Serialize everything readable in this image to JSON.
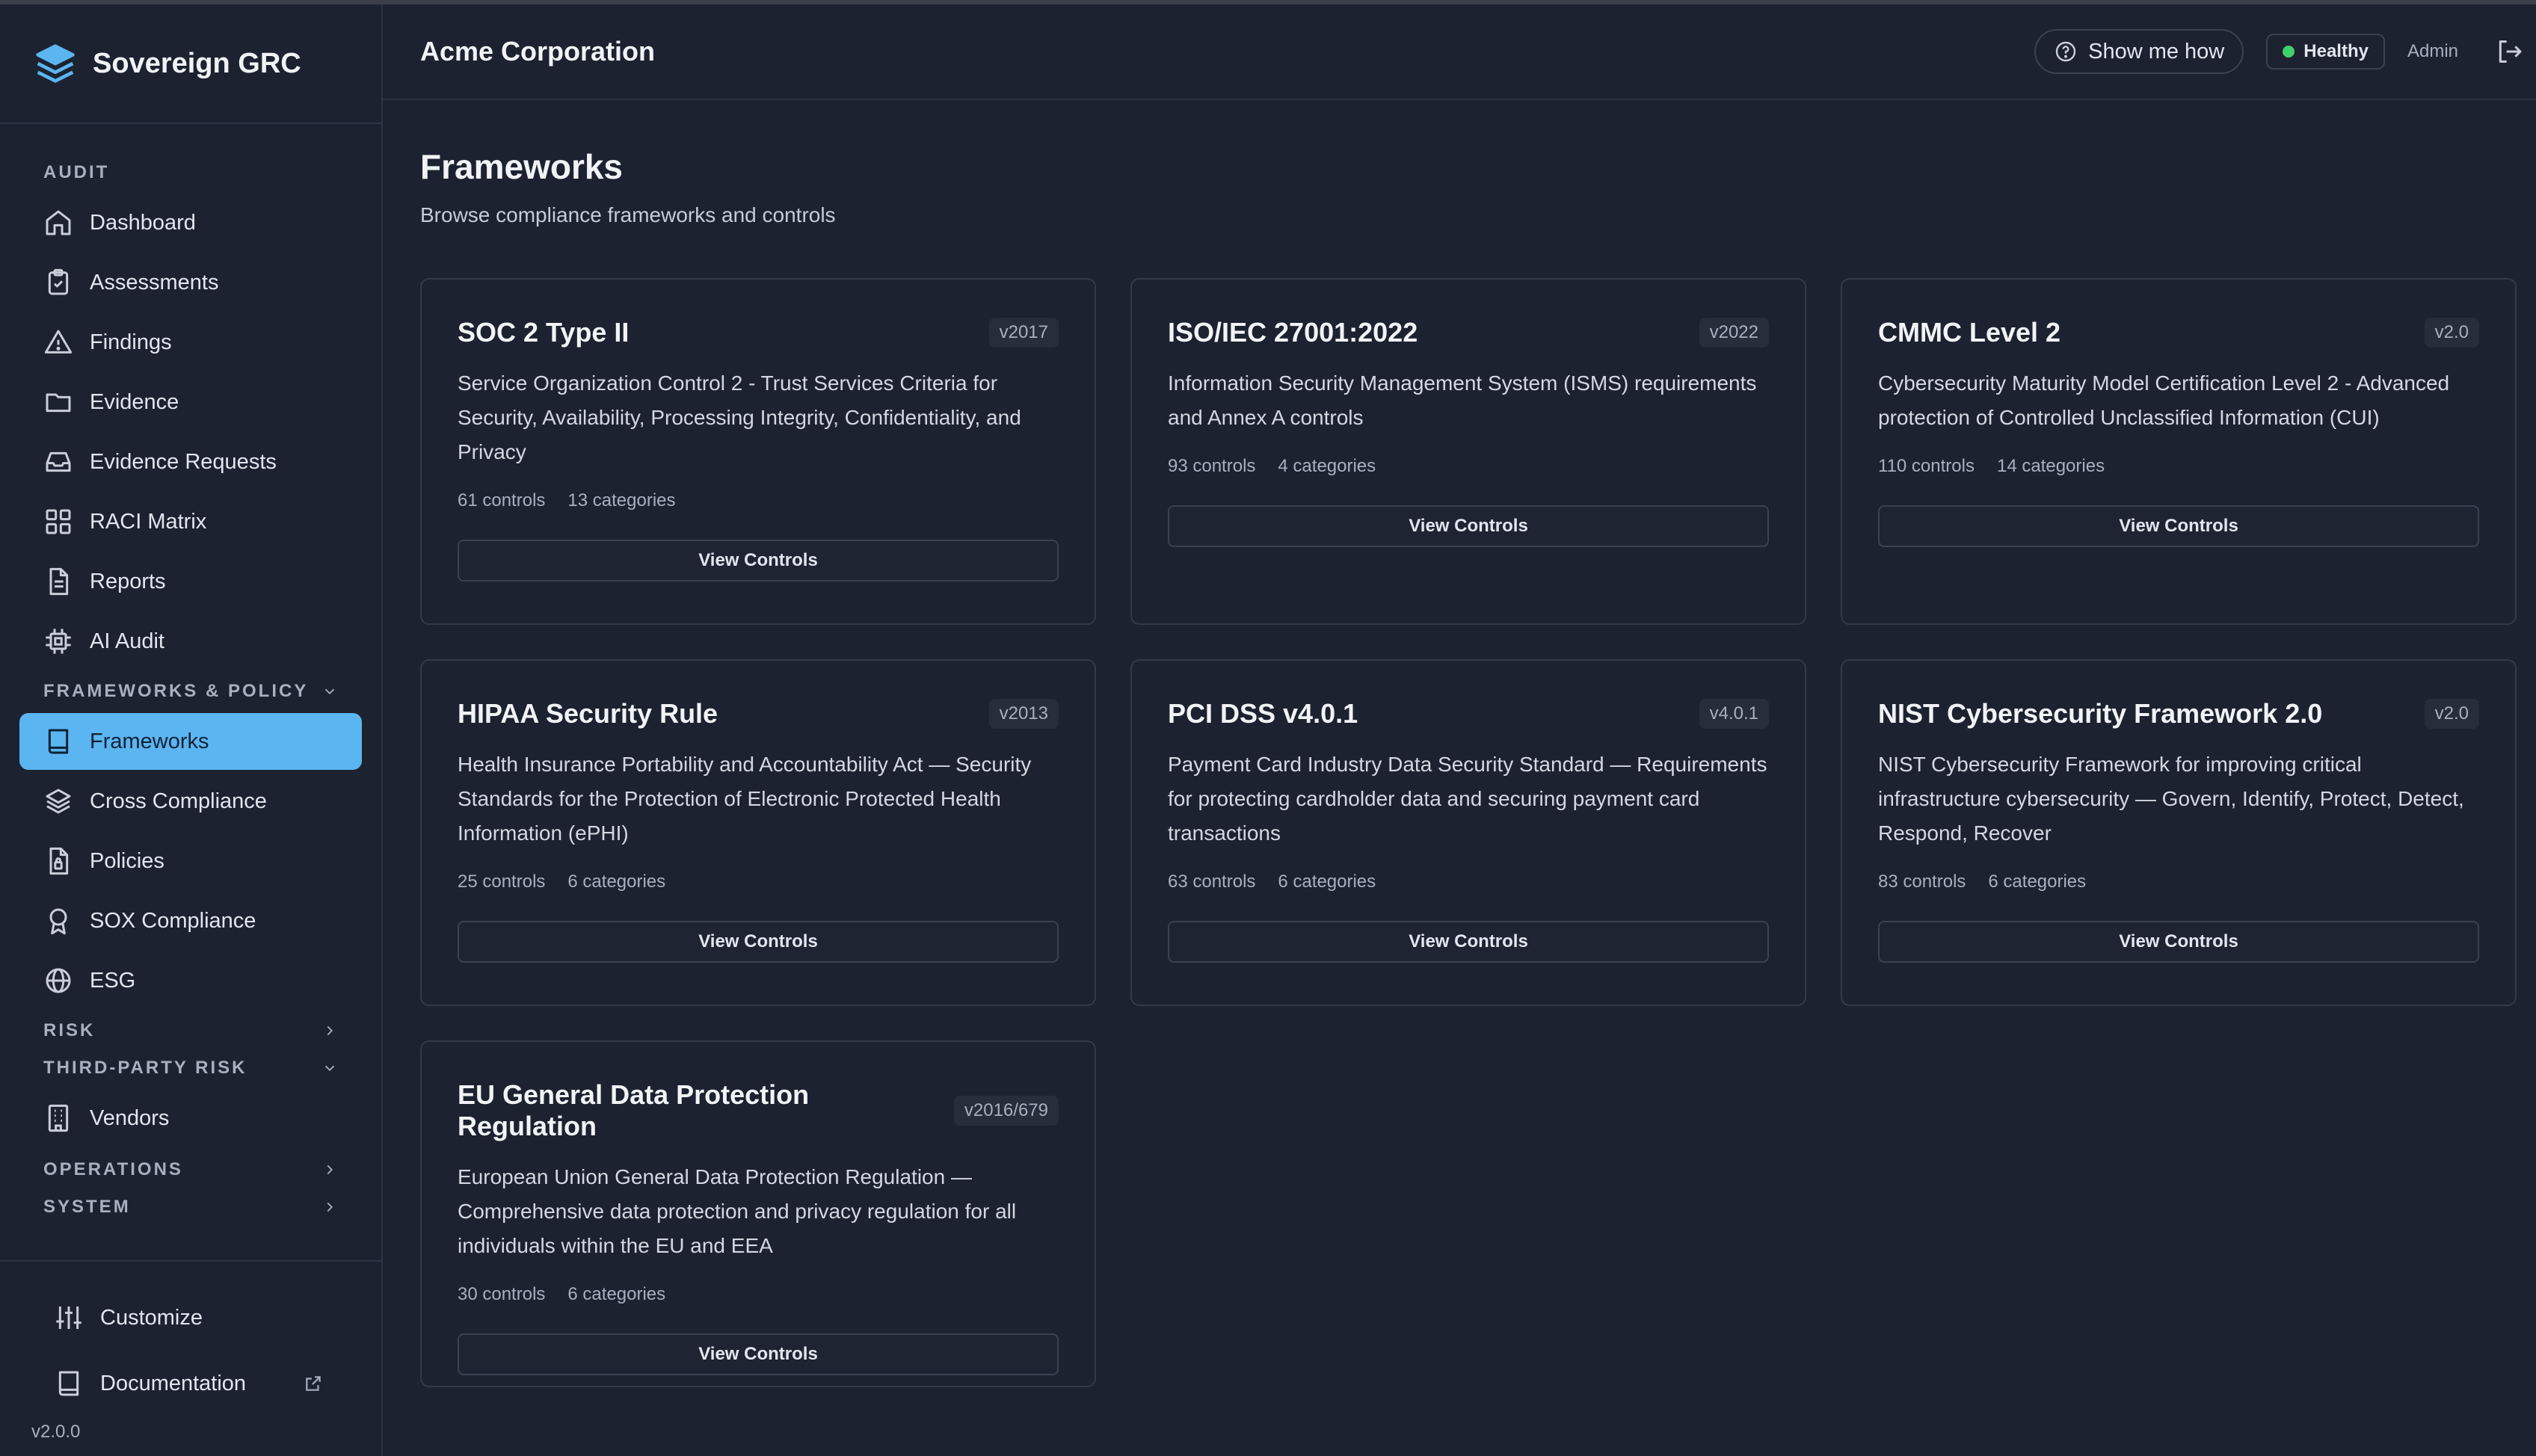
{
  "brand": {
    "name": "Sovereign GRC"
  },
  "sidebar": {
    "sections": {
      "audit": "AUDIT",
      "frameworks_policy": "FRAMEWORKS & POLICY",
      "risk": "RISK",
      "third_party_risk": "THIRD-PARTY RISK",
      "operations": "OPERATIONS",
      "system": "SYSTEM"
    },
    "audit_items": [
      "Dashboard",
      "Assessments",
      "Findings",
      "Evidence",
      "Evidence Requests",
      "RACI Matrix",
      "Reports",
      "AI Audit"
    ],
    "framework_items": [
      "Frameworks",
      "Cross Compliance",
      "Policies",
      "SOX Compliance",
      "ESG"
    ],
    "third_party_items": [
      "Vendors"
    ],
    "bottom": {
      "customize": "Customize",
      "documentation": "Documentation"
    },
    "version": "v2.0.0"
  },
  "topbar": {
    "org": "Acme Corporation",
    "help": "Show me how",
    "health": "Healthy",
    "role": "Admin"
  },
  "page": {
    "title": "Frameworks",
    "subtitle": "Browse compliance frameworks and controls"
  },
  "frameworks": [
    {
      "title": "SOC 2 Type II",
      "version": "v2017",
      "description": "Service Organization Control 2 - Trust Services Criteria for Security, Availability, Processing Integrity, Confidentiality, and Privacy",
      "controls": "61 controls",
      "categories": "13 categories",
      "button": "View Controls"
    },
    {
      "title": "ISO/IEC 27001:2022",
      "version": "v2022",
      "description": "Information Security Management System (ISMS) requirements and Annex A controls",
      "controls": "93 controls",
      "categories": "4 categories",
      "button": "View Controls"
    },
    {
      "title": "CMMC Level 2",
      "version": "v2.0",
      "description": "Cybersecurity Maturity Model Certification Level 2 - Advanced protection of Controlled Unclassified Information (CUI)",
      "controls": "110 controls",
      "categories": "14 categories",
      "button": "View Controls"
    },
    {
      "title": "HIPAA Security Rule",
      "version": "v2013",
      "description": "Health Insurance Portability and Accountability Act — Security Standards for the Protection of Electronic Protected Health Information (ePHI)",
      "controls": "25 controls",
      "categories": "6 categories",
      "button": "View Controls"
    },
    {
      "title": "PCI DSS v4.0.1",
      "version": "v4.0.1",
      "description": "Payment Card Industry Data Security Standard — Requirements for protecting cardholder data and securing payment card transactions",
      "controls": "63 controls",
      "categories": "6 categories",
      "button": "View Controls"
    },
    {
      "title": "NIST Cybersecurity Framework 2.0",
      "version": "v2.0",
      "description": "NIST Cybersecurity Framework for improving critical infrastructure cybersecurity — Govern, Identify, Protect, Detect, Respond, Recover",
      "controls": "83 controls",
      "categories": "6 categories",
      "button": "View Controls"
    },
    {
      "title": "EU General Data Protection Regulation",
      "version": "v2016/679",
      "description": "European Union General Data Protection Regulation — Comprehensive data protection and privacy regulation for all individuals within the EU and EEA",
      "controls": "30 controls",
      "categories": "6 categories",
      "button": "View Controls"
    }
  ],
  "colors": {
    "accent": "#5bb5f0",
    "background": "#1c2230",
    "healthy": "#3fcf6b"
  }
}
